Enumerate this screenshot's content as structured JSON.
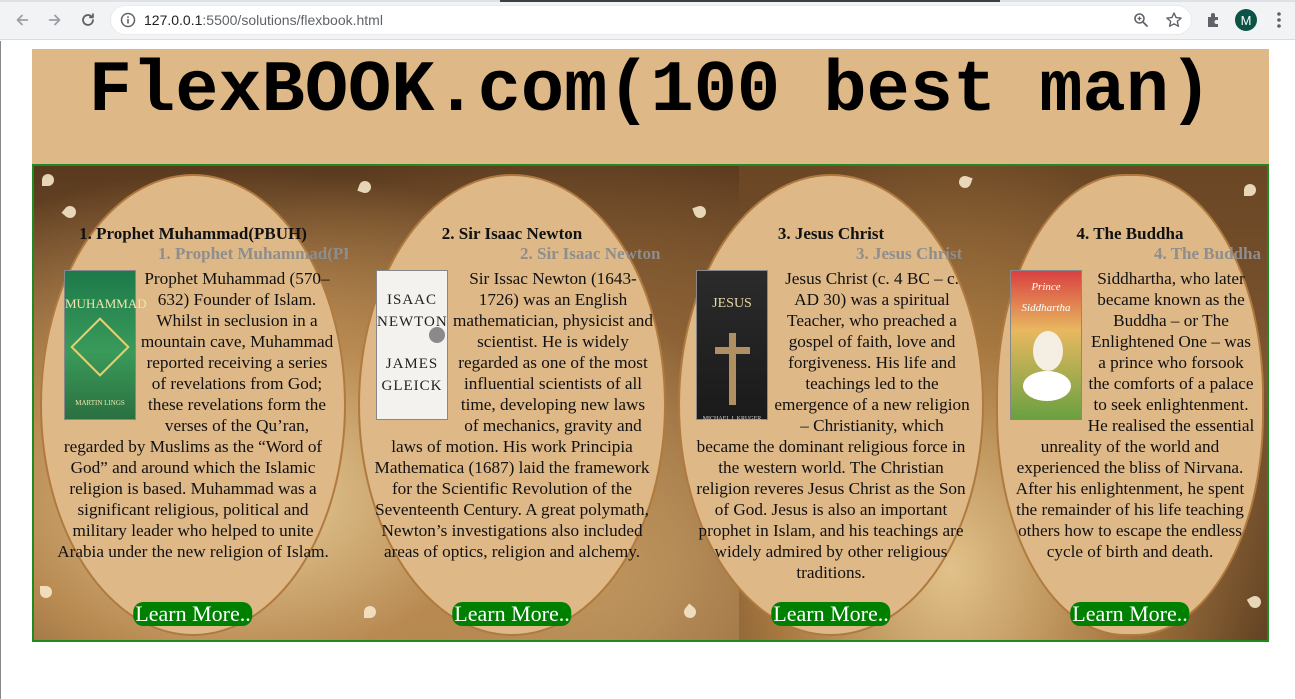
{
  "browser": {
    "url_host": "127.0.0.1",
    "url_path": ":5500/solutions/flexbook.html",
    "avatar_letter": "M"
  },
  "header": {
    "title": "FlexBOOK.com(100 best man)"
  },
  "cards": [
    {
      "title": "1. Prophet Muhammad(PBUH)",
      "shadow_title": "1. Prophet Muhammad(PBU",
      "text": "Prophet Muhammad (570–632) Founder of Islam. Whilst in seclusion in a mountain cave, Muhammad reported receiving a series of revelations from God; these revelations form the verses of the Qu’ran, regarded by Muslims as the “Word of God” and around which the Islamic religion is based. Muhammad was a significant religious, political and military leader who helped to unite Arabia under the new religion of Islam.",
      "cover_title": "MUHAMMAD",
      "cover_author": "MARTIN LINGS",
      "button": "Learn More.."
    },
    {
      "title": "2. Sir Isaac Newton",
      "shadow_title": "2. Sir Isaac Newton",
      "text": "Sir Issac Newton (1643-1726) was an English mathematician, physicist and scientist. He is widely regarded as one of the most influential scientists of all time, developing new laws of mechanics, gravity and laws of motion. His work Principia Mathematica (1687) laid the framework for the Scientific Revolution of the Seventeenth Century. A great polymath, Newton’s investigations also included areas of optics, religion and alchemy.",
      "cover_title": "ISAAC NEWTON",
      "cover_author": "JAMES GLEICK",
      "button": "Learn More.."
    },
    {
      "title": "3. Jesus Christ",
      "shadow_title": "3. Jesus Christ",
      "text": "Jesus Christ (c. 4 BC – c. AD 30) was a spiritual Teacher, who preached a gospel of faith, love and forgiveness. His life and teachings led to the emergence of a new religion – Christianity, which became the dominant religious force in the western world. The Christian religion reveres Jesus Christ as the Son of God. Jesus is also an important prophet in Islam, and his teachings are widely admired by other religious traditions.",
      "cover_title": "JESUS",
      "cover_author": "MICHAEL J. KRUGER",
      "button": "Learn More.."
    },
    {
      "title": "4. The Buddha",
      "shadow_title": "4. The Buddha",
      "text": "Siddhartha, who later became known as the Buddha – or The Enlightened One – was a prince who forsook the comforts of a palace to seek enlightenment. He realised the essential unreality of the world and experienced the bliss of Nirvana. After his enlightenment, he spent the remainder of his life teaching others how to escape the endless cycle of birth and death.",
      "cover_title": "Prince Siddhartha",
      "cover_author": "",
      "button": "Learn More.."
    }
  ]
}
